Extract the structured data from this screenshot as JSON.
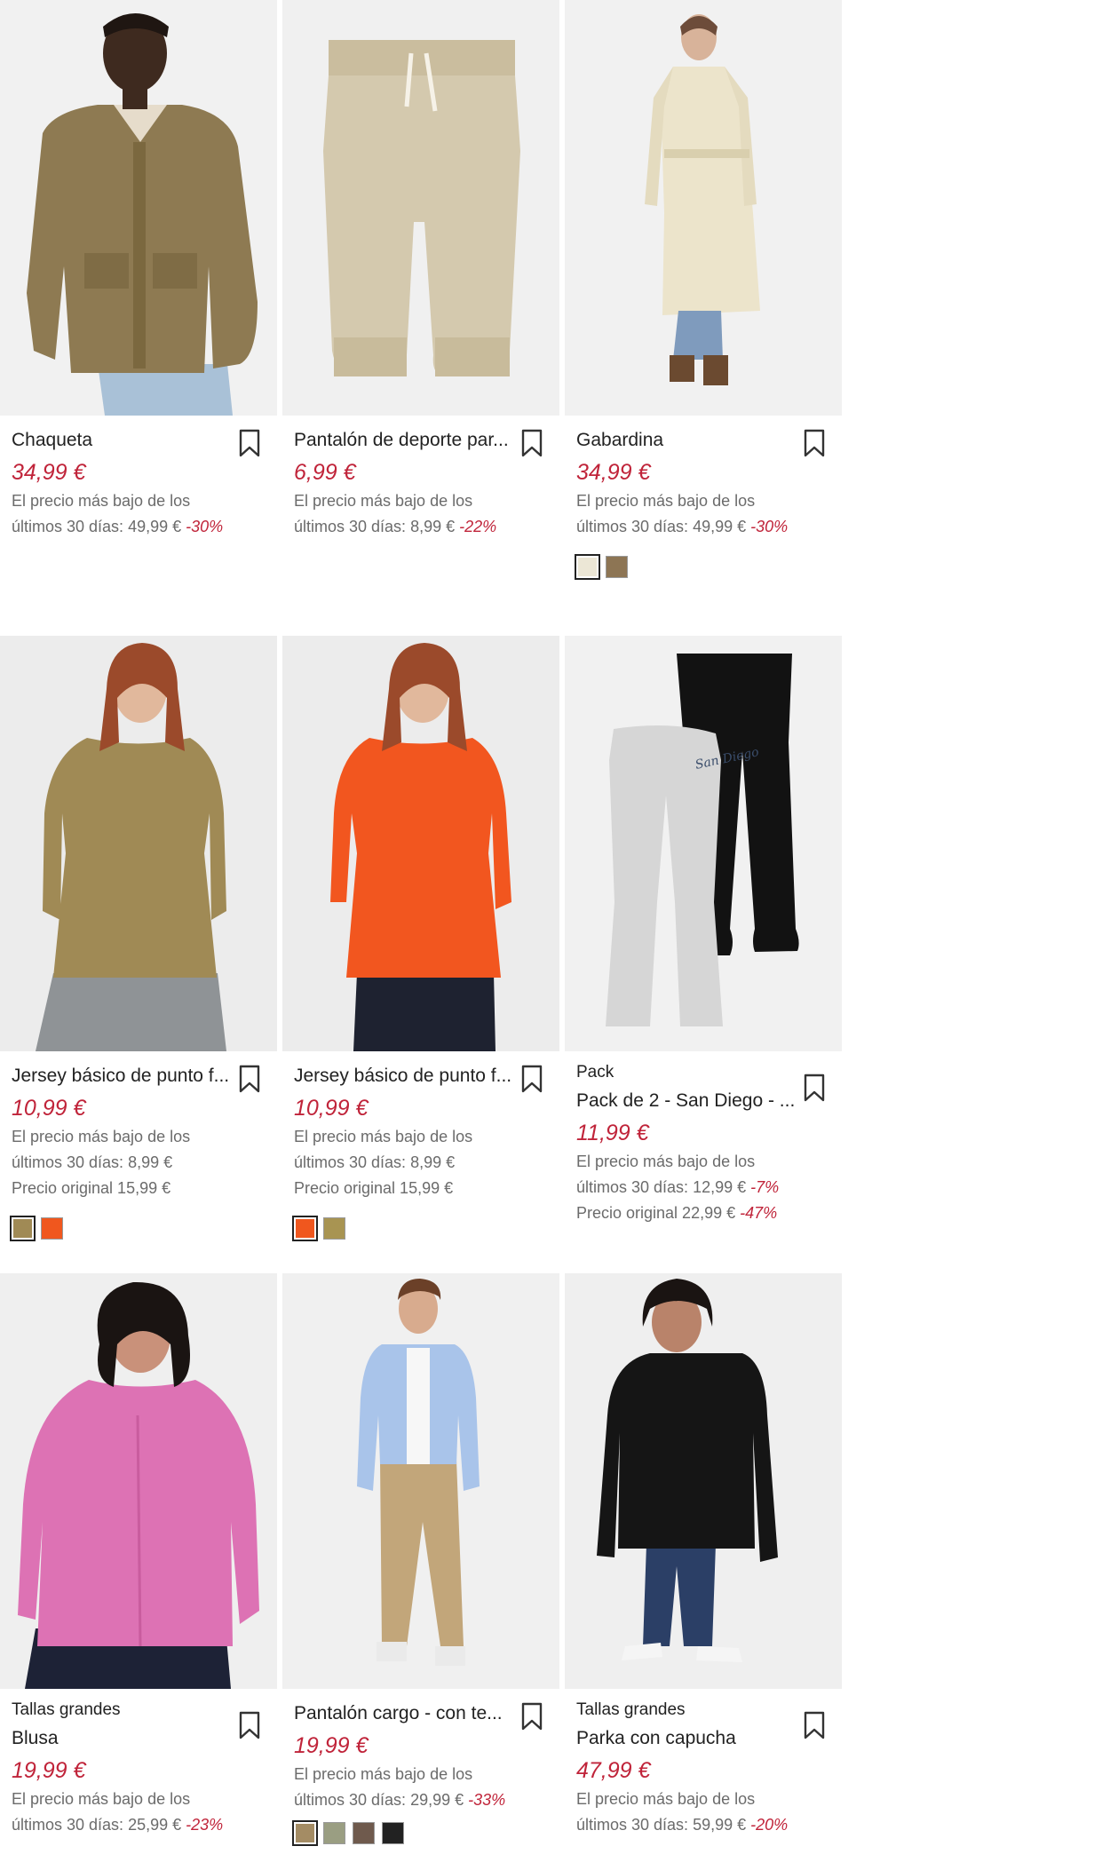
{
  "products": [
    {
      "name": "Chaqueta",
      "price": "34,99 €",
      "lowest_line1": "El precio más bajo de los",
      "lowest_line2": "últimos 30 días: 49,99 €",
      "lowest_discount": "-30%",
      "image": "man-olive-jacket",
      "colors": []
    },
    {
      "name": "Pantalón de deporte par...",
      "price": "6,99 €",
      "lowest_line1": "El precio más bajo de los",
      "lowest_line2": "últimos 30 días: 8,99 €",
      "lowest_discount": "-22%",
      "image": "beige-kids-joggers",
      "colors": []
    },
    {
      "name": "Gabardina",
      "price": "34,99 €",
      "lowest_line1": "El precio más bajo de los",
      "lowest_line2": "últimos 30 días: 49,99 €",
      "lowest_discount": "-30%",
      "image": "woman-trench-coat",
      "colors": [
        "#ece7d6",
        "#8d7554"
      ]
    },
    {
      "name": "Jersey básico de punto f...",
      "price": "10,99 €",
      "lowest_line1": "El precio más bajo de los",
      "lowest_line2": "últimos 30 días: 8,99 €",
      "original": "Precio original 15,99 €",
      "image": "woman-olive-sweater",
      "colors": [
        "#a08a55",
        "#f0571e"
      ]
    },
    {
      "name": "Jersey básico de punto f...",
      "price": "10,99 €",
      "lowest_line1": "El precio más bajo de los",
      "lowest_line2": "últimos 30 días: 8,99 €",
      "original": "Precio original 15,99 €",
      "image": "woman-orange-sweater",
      "colors": [
        "#f0571e",
        "#a89452"
      ]
    },
    {
      "tag": "Pack",
      "name": "Pack de 2 - San Diego - ...",
      "price": "11,99 €",
      "lowest_line1": "El precio más bajo de los",
      "lowest_line2": "últimos 30 días: 12,99 €",
      "lowest_discount": "-7%",
      "original": "Precio original 22,99 €",
      "original_discount": "-47%",
      "image": "flared-leggings-pack",
      "colors": []
    },
    {
      "tag": "Tallas grandes",
      "name": "Blusa",
      "price": "19,99 €",
      "lowest_line1": "El precio más bajo de los",
      "lowest_line2": "últimos 30 días: 25,99 €",
      "lowest_discount": "-23%",
      "image": "woman-pink-blouse",
      "colors": []
    },
    {
      "name": "Pantalón cargo - con te...",
      "price": "19,99 €",
      "lowest_line1": "El precio más bajo de los",
      "lowest_line2": "últimos 30 días: 29,99 €",
      "lowest_discount": "-33%",
      "image": "man-cargo-pants",
      "colors": [
        "#a48c64",
        "#9a9e82",
        "#6f5a4d",
        "#222222"
      ]
    },
    {
      "tag": "Tallas grandes",
      "name": "Parka con capucha",
      "price": "47,99 €",
      "lowest_line1": "El precio más bajo de los",
      "lowest_line2": "últimos 30 días: 59,99 €",
      "lowest_discount": "-20%",
      "image": "woman-black-parka",
      "colors": []
    }
  ],
  "icons": {
    "bookmark": "bookmark-icon"
  },
  "accent": "#c0243a"
}
